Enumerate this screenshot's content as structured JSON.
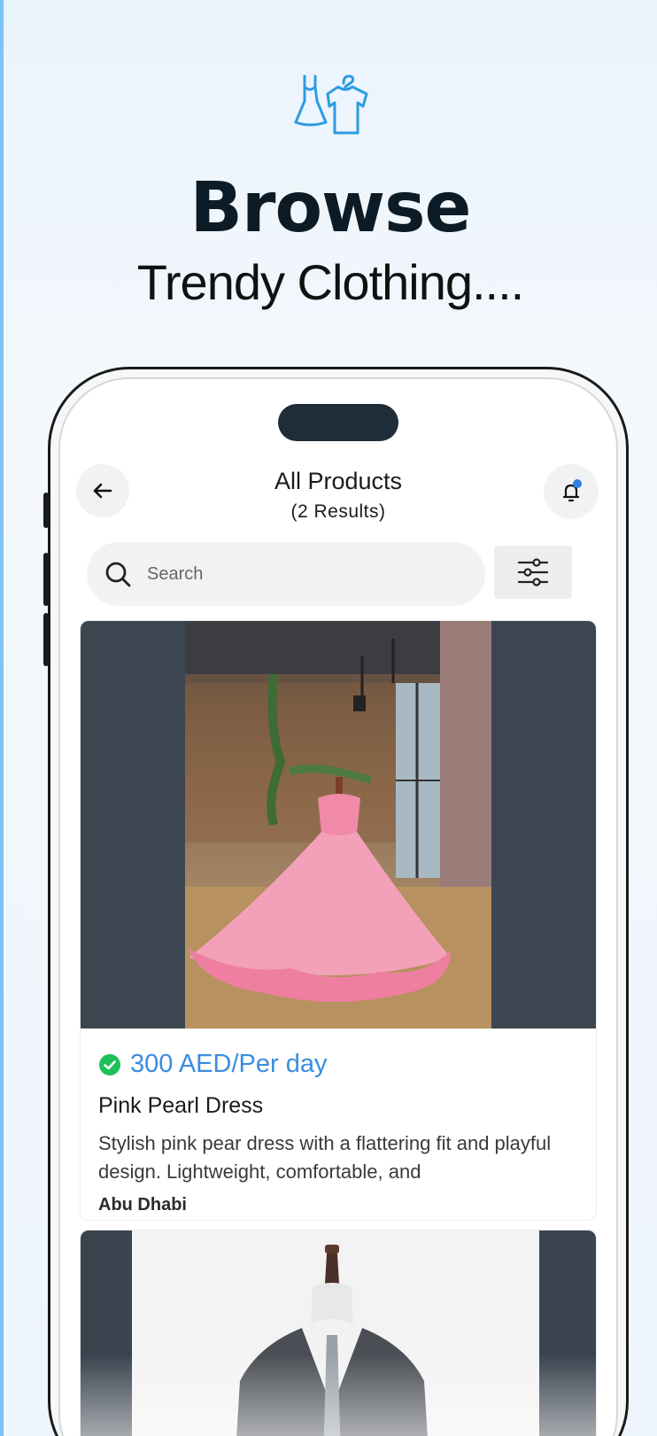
{
  "hero": {
    "icon": "clothes-hanger-icon",
    "title": "Browse",
    "subtitle": "Trendy Clothing...."
  },
  "header": {
    "back_icon": "arrow-left-icon",
    "title": "All Products",
    "count": "(2 Results)",
    "bell_icon": "bell-icon"
  },
  "search": {
    "placeholder": "Search",
    "value": "",
    "filter_icon": "sliders-icon"
  },
  "products": [
    {
      "verified_icon": "check-circle-icon",
      "price": "300 AED/Per day",
      "name": "Pink Pearl Dress",
      "description": "Stylish pink pear dress with a flattering fit and playful design. Lightweight, comfortable, and",
      "location": "Abu Dhabi"
    }
  ],
  "colors": {
    "accent": "#3a8de0",
    "verified": "#1fbf5a",
    "notification_dot": "#2f7fe0",
    "title": "#0d1b26"
  }
}
